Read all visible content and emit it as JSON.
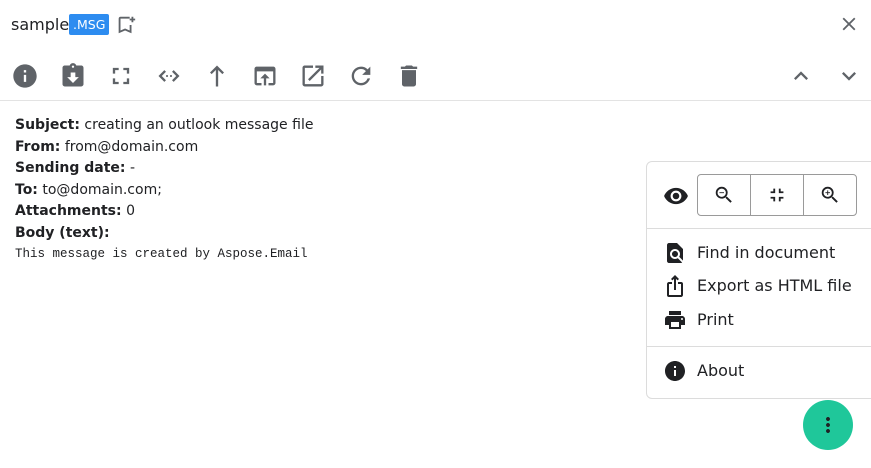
{
  "header": {
    "file_name": "sample",
    "extension": ".MSG",
    "bookmark_icon": "bookmark-add-icon",
    "close_icon": "close-icon"
  },
  "toolbar": {
    "icons": [
      "info-icon",
      "save-icon",
      "fullscreen-icon",
      "code-icon",
      "upload-icon",
      "publish-icon",
      "open-external-icon",
      "reload-icon",
      "delete-icon",
      "chevron-up-icon",
      "chevron-down-icon"
    ]
  },
  "message": {
    "subject_label": "Subject:",
    "subject": "creating an outlook message file",
    "from_label": "From:",
    "from": "from@domain.com",
    "date_label": "Sending date:",
    "date": "-",
    "to_label": "To:",
    "to": "to@domain.com;",
    "attachments_label": "Attachments:",
    "attachments": "0",
    "body_label": "Body (text):",
    "body": "This message is created by Aspose.Email"
  },
  "menu": {
    "find": "Find in document",
    "export": "Export as HTML file",
    "print": "Print",
    "about": "About"
  },
  "colors": {
    "badge": "#2d8cf0",
    "fab": "#1fc79a",
    "icon": "#5f6368"
  }
}
